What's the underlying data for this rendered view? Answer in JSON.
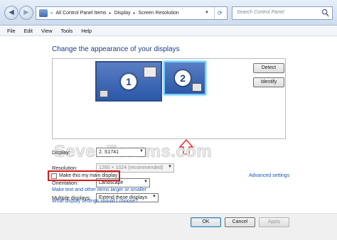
{
  "address": {
    "crumbs": [
      "All Control Panel Items",
      "Display",
      "Screen Resolution"
    ],
    "search_placeholder": "Search Control Panel"
  },
  "menu": [
    "File",
    "Edit",
    "View",
    "Tools",
    "Help"
  ],
  "heading": "Change the appearance of your displays",
  "monitors": {
    "monitor1_number": "1",
    "monitor2_number": "2",
    "detect_label": "Detect",
    "identify_label": "Identify"
  },
  "watermark": "SevenForums.com",
  "fields": {
    "display_label": "Display:",
    "display_value": "2. S1741",
    "resolution_label": "Resolution:",
    "resolution_value": "1280 × 1024 (recommended)",
    "orientation_label": "Orientation:",
    "orientation_value": "Landscape",
    "multiple_label": "Multiple displays:",
    "multiple_value": "Extend these displays"
  },
  "main_display_label": "Make this my main display",
  "main_display_checked": false,
  "links": {
    "advanced": "Advanced settings",
    "text_size": "Make text and other items larger or smaller",
    "which_settings": "What display settings should I choose?"
  },
  "buttons": {
    "ok": "OK",
    "cancel": "Cancel",
    "apply": "Apply"
  },
  "colors": {
    "heading": "#1e3a8a",
    "highlight_border": "#d61a1a",
    "link": "#1a55b8"
  }
}
